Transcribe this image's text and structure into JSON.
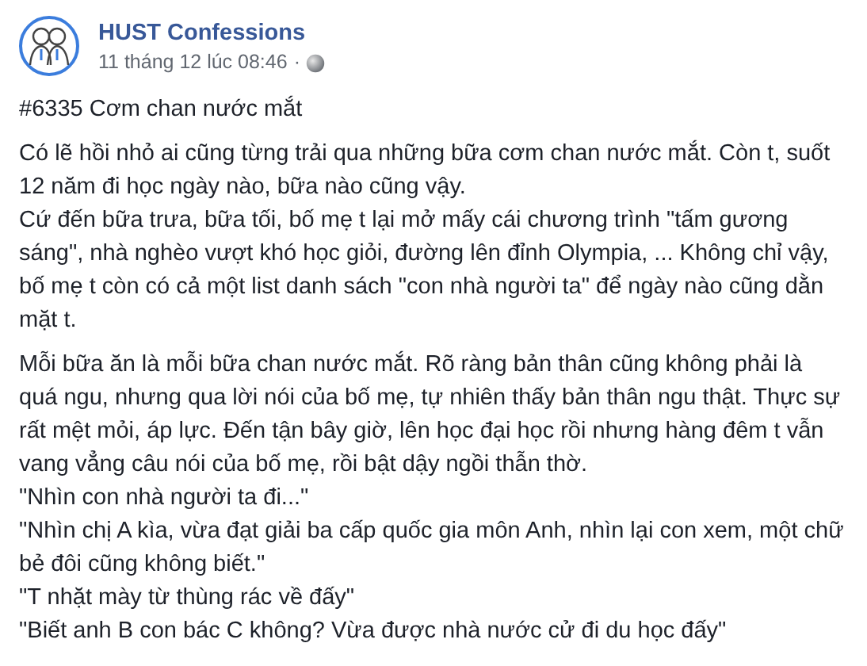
{
  "post": {
    "author": "HUST Confessions",
    "timestamp": "11 tháng 12 lúc 08:46",
    "separator": "·",
    "paragraphs": [
      {
        "lines": [
          "#6335 Cơm chan nước mắt"
        ]
      },
      {
        "lines": [
          "Có lẽ hồi nhỏ ai cũng từng trải qua những bữa cơm chan nước mắt. Còn t, suốt 12 năm đi học ngày nào, bữa nào cũng vậy.",
          "Cứ đến bữa trưa, bữa tối, bố mẹ t lại mở mấy cái chương trình \"tấm gương sáng\", nhà nghèo vượt khó học giỏi, đường lên đỉnh Olympia, ... Không chỉ vậy, bố mẹ t còn có cả một list danh sách \"con nhà người ta\" để ngày nào cũng dằn mặt t."
        ]
      },
      {
        "lines": [
          "Mỗi bữa ăn là mỗi bữa chan nước mắt. Rõ ràng bản thân cũng không phải là quá ngu, nhưng qua lời nói của bố mẹ, tự nhiên thấy bản thân ngu thật. Thực sự rất mệt mỏi, áp lực. Đến tận bây giờ, lên học đại học rồi nhưng hàng đêm t vẫn vang vẳng câu nói của bố mẹ, rồi bật dậy ngồi thẫn thờ.",
          "\"Nhìn con nhà người ta đi...\"",
          "\"Nhìn chị A kìa, vừa đạt giải ba cấp quốc gia môn Anh, nhìn lại con xem, một chữ bẻ đôi cũng không biết.\"",
          "\"T nhặt mày từ thùng rác về đấy\"",
          "\"Biết anh B con bác C không? Vừa được nhà nước cử đi du học đấy\""
        ]
      }
    ]
  }
}
